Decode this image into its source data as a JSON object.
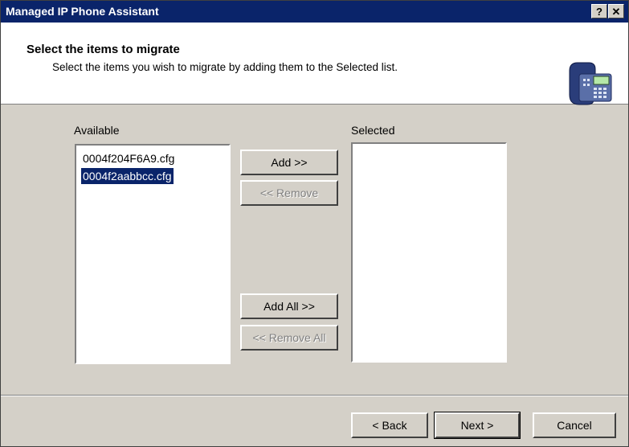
{
  "window": {
    "title": "Managed IP Phone Assistant",
    "help_label": "?",
    "close_label": "✕"
  },
  "header": {
    "heading": "Select the items to migrate",
    "subheading": "Select the items you wish to migrate by adding them to the Selected list.",
    "icon": "desk-phone-icon"
  },
  "available": {
    "label": "Available",
    "items": [
      "0004f204F6A9.cfg",
      "0004f2aabbcc.cfg"
    ],
    "selected_index": 1
  },
  "selected": {
    "label": "Selected",
    "items": []
  },
  "buttons": {
    "add": "Add >>",
    "remove": "<< Remove",
    "add_all": "Add All >>",
    "remove_all": "<< Remove All",
    "back": "< Back",
    "next": "Next >",
    "cancel": "Cancel"
  },
  "colors": {
    "titlebar": "#0a246a",
    "selection": "#0a246a",
    "face": "#d4d0c8"
  }
}
